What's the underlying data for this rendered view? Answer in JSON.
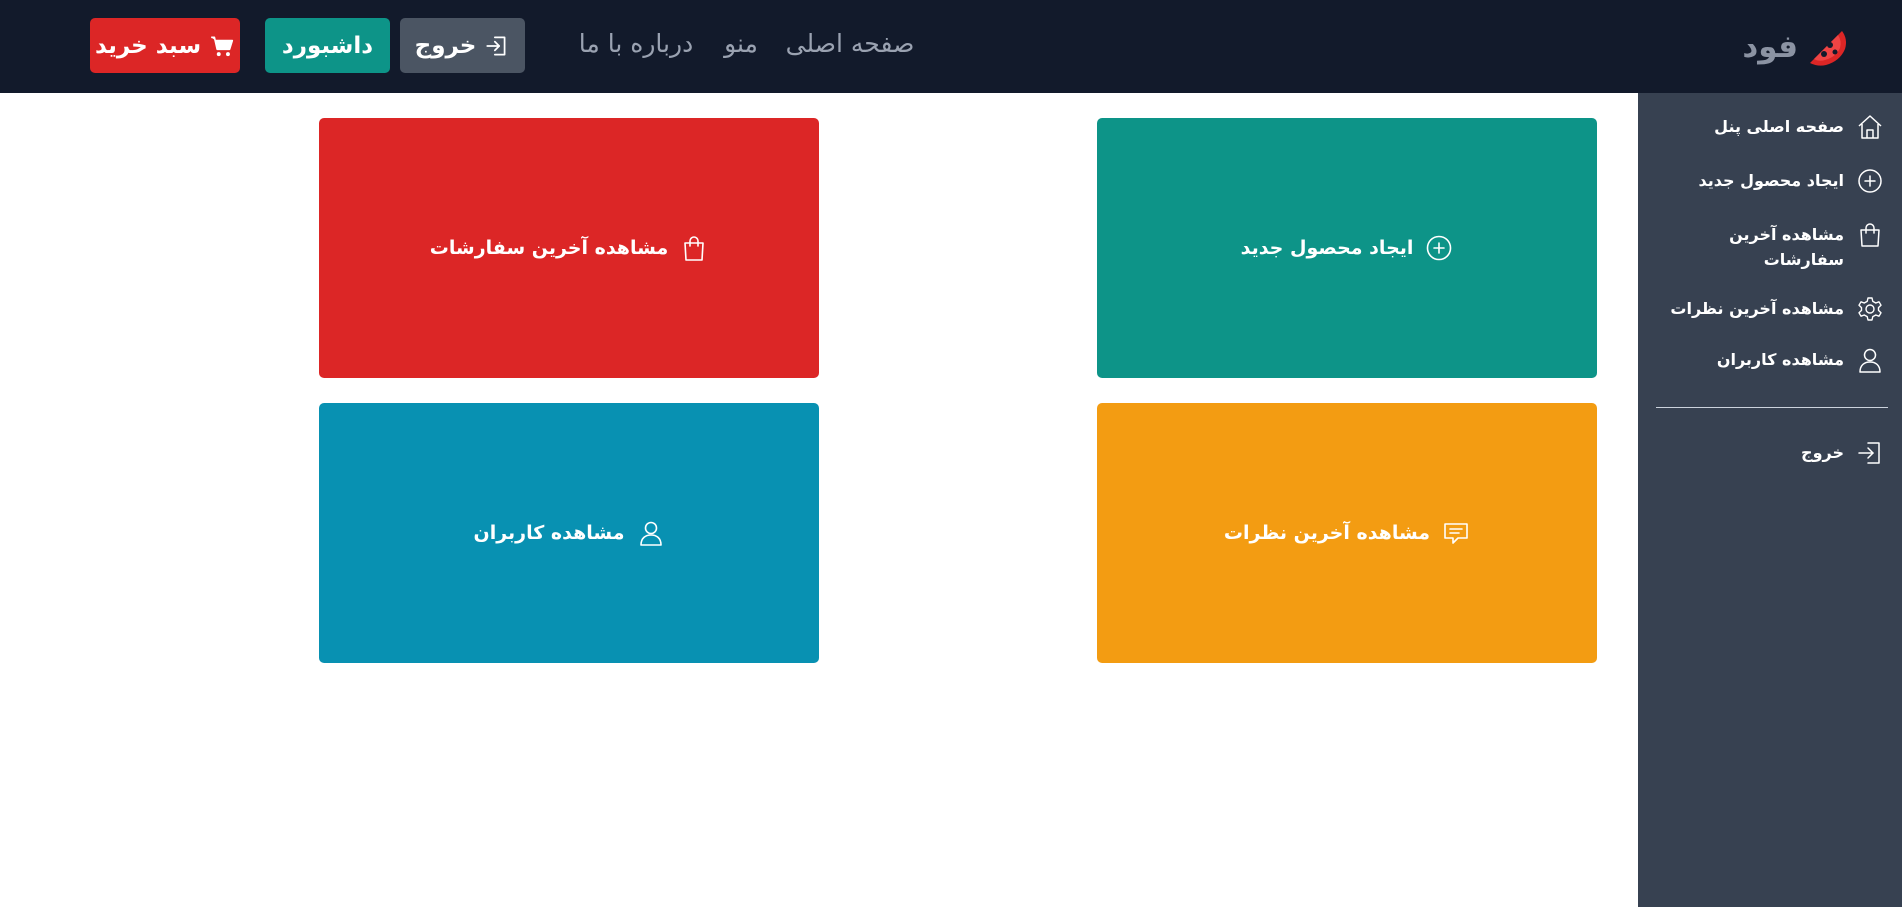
{
  "brand": {
    "name": "فود",
    "icon": "pizza-slice-icon",
    "color": "#dc2626"
  },
  "nav": {
    "links": [
      {
        "label": "صفحه اصلی"
      },
      {
        "label": "منو"
      },
      {
        "label": "درباره با ما"
      }
    ],
    "logout_button": {
      "label": "خروج",
      "icon": "logout-icon",
      "color": "#4b5563"
    },
    "dashboard_button": {
      "label": "داشبورد",
      "color": "#0d9488"
    },
    "cart_button": {
      "label": "سبد خرید",
      "icon": "cart-icon",
      "color": "#dc2626"
    }
  },
  "sidebar": {
    "items": [
      {
        "label": "صفحه اصلی پنل",
        "icon": "home-icon"
      },
      {
        "label": "ایجاد محصول جدید",
        "icon": "plus-circle-icon"
      },
      {
        "label": "مشاهده آخرین سفارشات",
        "icon": "shopping-bag-icon"
      },
      {
        "label": "مشاهده آخرین نظرات",
        "icon": "gear-icon"
      },
      {
        "label": "مشاهده کاربران",
        "icon": "user-icon"
      }
    ],
    "logout": {
      "label": "خروج",
      "icon": "logout-icon"
    }
  },
  "cards": {
    "create_product": {
      "label": "ایجاد محصول جدید",
      "icon": "plus-circle-icon",
      "color": "#0d9488"
    },
    "latest_orders": {
      "label": "مشاهده آخرین سفارشات",
      "icon": "shopping-bag-icon",
      "color": "#dc2626"
    },
    "latest_comments": {
      "label": "مشاهده آخرین نظرات",
      "icon": "comment-icon",
      "color": "#f39c12"
    },
    "users": {
      "label": "مشاهده کاربران",
      "icon": "user-icon",
      "color": "#0891b2"
    }
  }
}
